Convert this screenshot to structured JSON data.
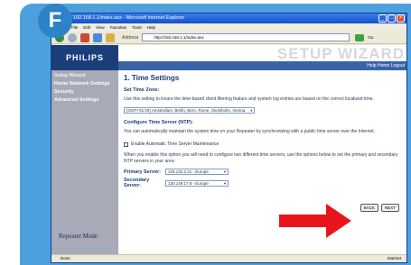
{
  "badge": "F",
  "window": {
    "title": "192.168.1.1/index.asx - Microsoft Internet Explorer",
    "menu": [
      "File",
      "Edit",
      "View",
      "Favorites",
      "Tools",
      "Help"
    ],
    "address_label": "Address",
    "address_value": "http://192.168.1.1/index.asx",
    "go_label": "Go",
    "status_left": "Done",
    "status_right": "Internet"
  },
  "header": {
    "logo": "PHILIPS",
    "title": "SETUP WIZARD",
    "help_links": "Help  Home  Logout"
  },
  "sidebar": {
    "items": [
      "Setup Wizard",
      "Home Network Settings",
      "Security",
      "Advanced Settings"
    ],
    "footer": "Repeater Mode"
  },
  "content": {
    "heading": "1. Time Settings",
    "set_time_zone": "Set Time Zone:",
    "tz_text": "Use this setting to insure the time-based client filtering feature and system log entries are based on the correct localized time.",
    "tz_value": "(GMT+01:00) Amsterdam, Berlin, Bern, Rome, Stockholm, Vienna",
    "ntp_heading": "Configure Time Server (NTP):",
    "ntp_text": "You can automatically maintain the system time on your Repeater by synchronizing with a public time server over the Internet.",
    "checkbox_label": "Enable Automatic Time Server Maintenance",
    "enable_text": "When you enable this option you will need to configure two different time servers, use the options below to set the primary and secondary NTP servers in your area:",
    "primary_label": "Primary Server:",
    "primary_value": "129.132.2.21 - Europe",
    "secondary_label": "Secondary Server:",
    "secondary_value": "130.149.17.8 - Europe",
    "back_label": "BACK",
    "next_label": "NEXT"
  },
  "colors": {
    "frame": "#4da0dc",
    "philips_blue": "#1b3d7a",
    "sidebar": "#a7aab7",
    "arrow": "#e8141c"
  }
}
